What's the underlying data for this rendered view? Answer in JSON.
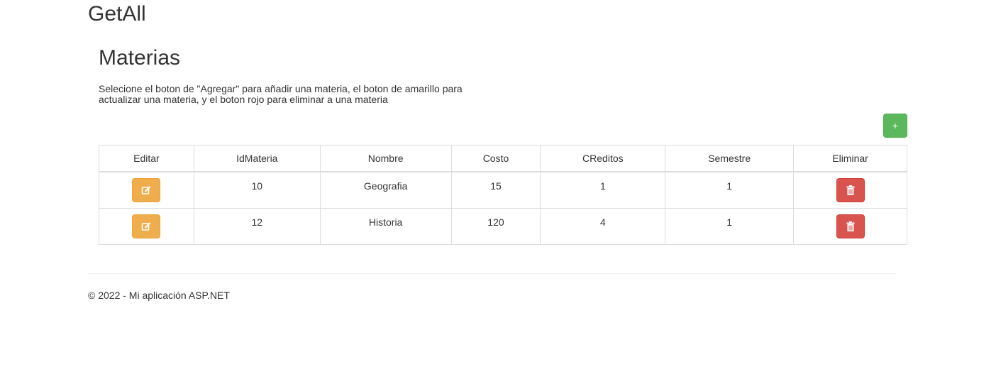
{
  "app": {
    "title": "GetAll"
  },
  "section": {
    "title": "Materias",
    "instructions": "Selecione el boton de \"Agregar\" para añadir una materia, el boton de amarillo para actualizar una materia, y el boton rojo para eliminar a una materia"
  },
  "toolbar": {
    "add_label": "+"
  },
  "table": {
    "headers": [
      "Editar",
      "IdMateria",
      "Nombre",
      "Costo",
      "CReditos",
      "Semestre",
      "Eliminar"
    ],
    "rows": [
      {
        "id": "10",
        "nombre": "Geografia",
        "costo": "15",
        "creditos": "1",
        "semestre": "1"
      },
      {
        "id": "12",
        "nombre": "Historia",
        "costo": "120",
        "creditos": "4",
        "semestre": "1"
      }
    ],
    "edit_icon": "edit-icon",
    "delete_icon": "trash-icon"
  },
  "footer": {
    "text": "© 2022 - Mi aplicación ASP.NET"
  },
  "colors": {
    "success": "#5cb85c",
    "warning": "#f0ad4e",
    "danger": "#d9534f",
    "border": "#dddddd",
    "text": "#333333"
  }
}
